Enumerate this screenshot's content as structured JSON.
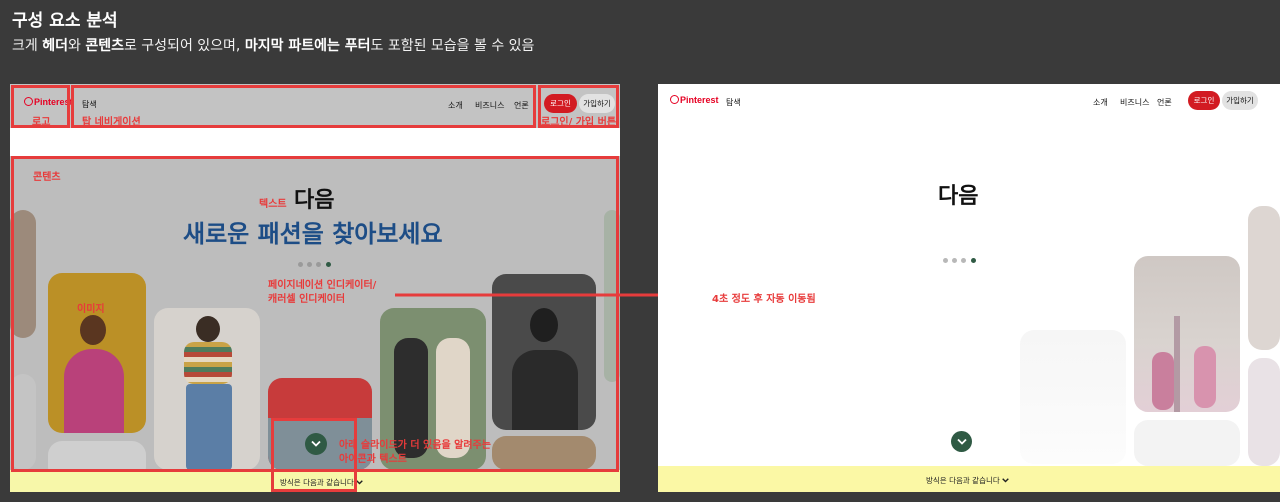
{
  "slide": {
    "title": "구성 요소 분석",
    "sub_1": "크게 ",
    "sub_header": "헤더",
    "sub_2": "와 ",
    "sub_contents": "콘텐츠",
    "sub_3": "로 구성되어 있으며, ",
    "sub_last": "마지막 파트에는 푸터",
    "sub_4": "도 포함된 모습을 볼 수 있음"
  },
  "site": {
    "logo": "Pinterest",
    "explore": "탐색",
    "nav": [
      "소개",
      "비즈니스",
      "언론"
    ],
    "login": "로그인",
    "signup": "가입하기",
    "headline_1": "다음",
    "headline_2": "새로운 패션을 찾아보세요",
    "footer": "방식은 다음과 같습니다"
  },
  "annotations": {
    "logo": "로고",
    "top_nav": "탑 네비게이션",
    "login_signup": "로그인/ 가입 버튼",
    "contents": "콘텐츠",
    "text": "텍스트",
    "image": "이미지",
    "indicator_1": "페이지네이션 인디케이터/",
    "indicator_2": "캐러셀 인디케이터",
    "more_1": "아래 슬라이드가 더 있음을 알려주는",
    "more_2": "아이콘과 텍스트",
    "auto": "4초 정도 후 자동 이동됨"
  },
  "carousel": {
    "pages": 4,
    "active_page": 4
  },
  "colors": {
    "background": "#3a3a3a",
    "annotation": "#e63c3c",
    "brand": "#e60023",
    "login_button": "#d21b22",
    "headline_blue": "#1d4d86",
    "chevron_button": "#2f5a44",
    "footer": "#f7f7a9"
  },
  "icons": [
    "pinterest-logo-icon",
    "chevron-down-icon",
    "arrow-right-icon"
  ]
}
